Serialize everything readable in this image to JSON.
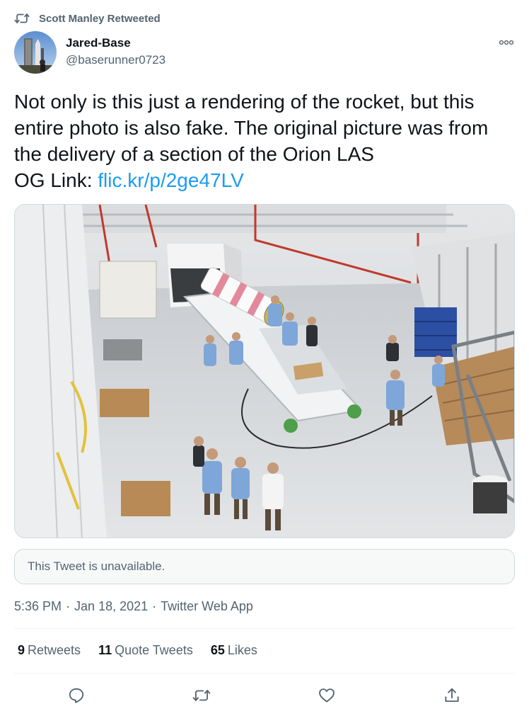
{
  "retweet_header": {
    "text": "Scott Manley Retweeted",
    "icon": "retweet-icon"
  },
  "author": {
    "name": "Jared-Base",
    "handle": "@baserunner0723",
    "avatar": "rocket-launch-pad-avatar"
  },
  "menu": {
    "icon": "more-options-icon"
  },
  "tweet": {
    "lines": [
      "Not only is this just a rendering of the rocket, but this",
      "entire photo is also fake. The original picture was from",
      "the delivery of a section of the Orion LAS"
    ],
    "link_prefix": "OG Link: ",
    "link_text": "flic.kr/p/2ge47LV"
  },
  "media": {
    "description_icon": "hangar-photo"
  },
  "quoted_tweet": {
    "text": "This Tweet is unavailable."
  },
  "timestamp": {
    "time": "5:36 PM",
    "separator": "·",
    "date": "Jan 18, 2021",
    "source": "Twitter Web App"
  },
  "stats": {
    "retweets_count": "9",
    "retweets_label": "Retweets",
    "quotes_count": "11",
    "quotes_label": "Quote Tweets",
    "likes_count": "65",
    "likes_label": "Likes"
  },
  "actions": {
    "reply_icon": "reply-icon",
    "retweet_icon": "retweet-icon",
    "like_icon": "heart-icon",
    "share_icon": "share-icon"
  },
  "colors": {
    "link": "#1d9bf0",
    "secondary_text": "#536471",
    "border": "#cfd9de"
  }
}
